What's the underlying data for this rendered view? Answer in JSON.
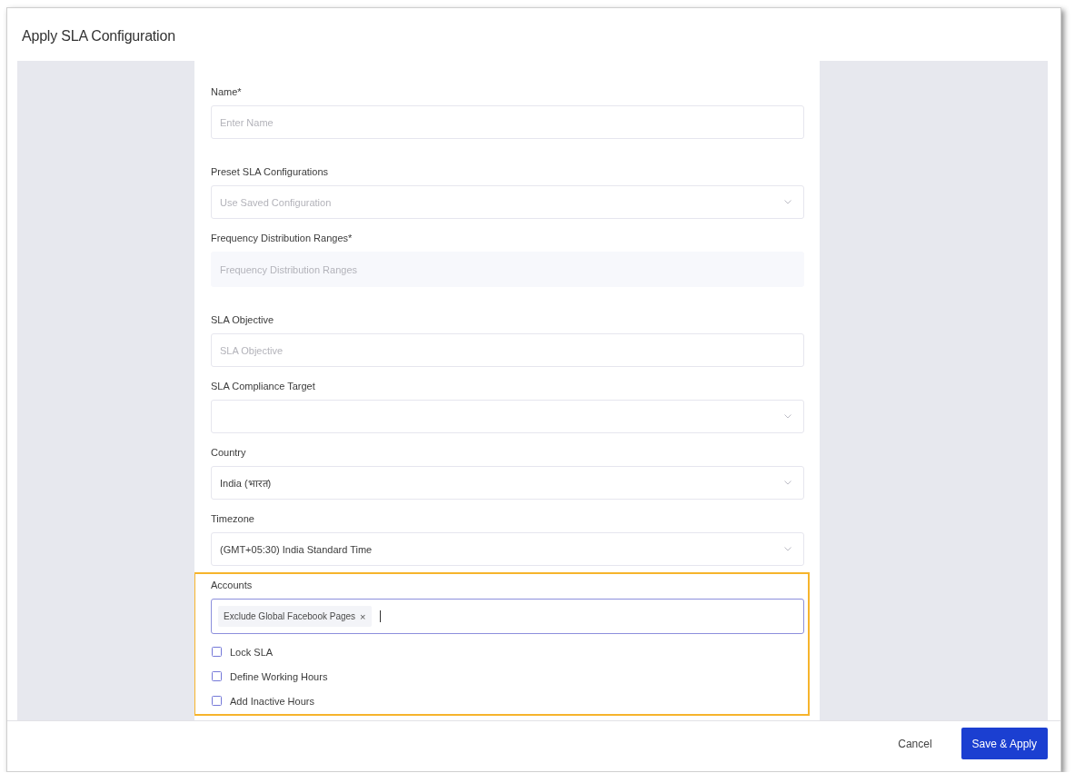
{
  "dialog": {
    "title": "Apply SLA Configuration"
  },
  "form": {
    "fields": [
      {
        "kind": "text",
        "label": "Name*",
        "placeholder": "Enter Name"
      },
      {
        "kind": "select",
        "label": "Preset SLA Configurations",
        "placeholder": "Use Saved Configuration"
      },
      {
        "kind": "readonly",
        "label": "Frequency Distribution Ranges*",
        "placeholder": "Frequency Distribution Ranges"
      },
      {
        "kind": "text",
        "label": "SLA Objective",
        "placeholder": "SLA Objective"
      },
      {
        "kind": "select",
        "label": "SLA Compliance Target"
      },
      {
        "kind": "select",
        "label": "Country",
        "value": "India (भारत)"
      },
      {
        "kind": "select",
        "label": "Timezone",
        "value": "(GMT+05:30) India Standard Time"
      }
    ],
    "section": {
      "highlighted": true,
      "accounts": {
        "label": "Accounts",
        "focused": true,
        "tags": [
          {
            "text": "Exclude Global Facebook Pages",
            "remove": "×"
          }
        ]
      },
      "options": [
        {
          "label": "Lock SLA",
          "checked": false
        },
        {
          "label": "Define Working Hours",
          "checked": false
        },
        {
          "label": "Add Inactive Hours",
          "checked": false
        }
      ]
    }
  },
  "footer": {
    "buttons": [
      {
        "kind": "secondary",
        "label": "Cancel"
      },
      {
        "kind": "primary",
        "label": "Save & Apply"
      }
    ]
  }
}
